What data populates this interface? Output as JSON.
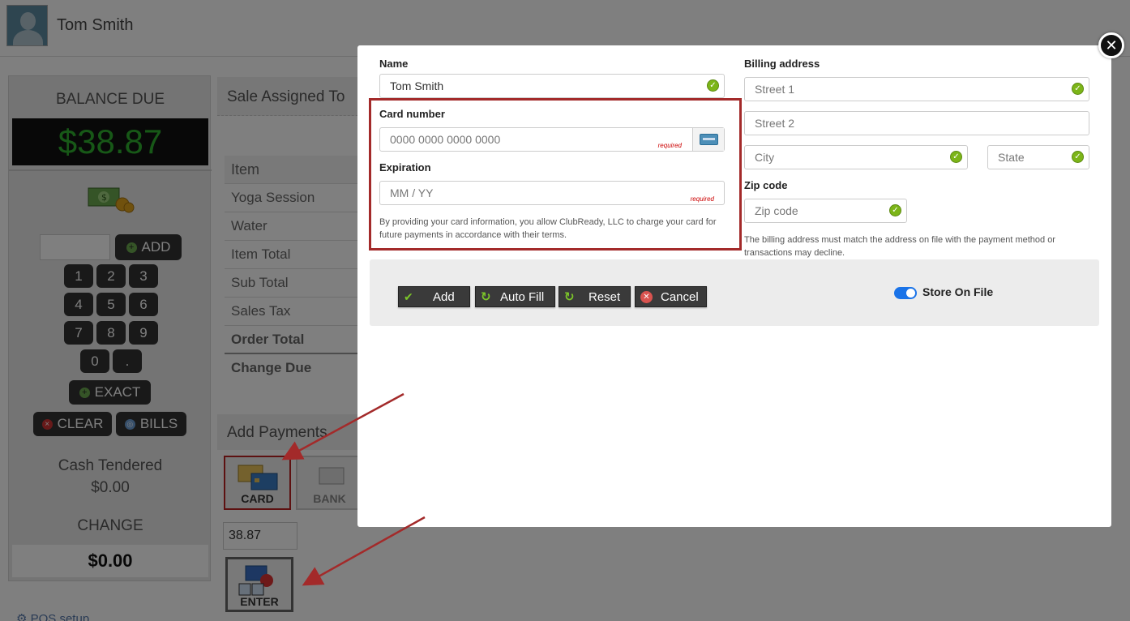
{
  "user": {
    "name": "Tom Smith"
  },
  "pos": {
    "balance_label": "BALANCE DUE",
    "balance_value": "$38.87",
    "add_label": "ADD",
    "keys": [
      "1",
      "2",
      "3",
      "4",
      "5",
      "6",
      "7",
      "8",
      "9",
      "0",
      "."
    ],
    "exact_label": "EXACT",
    "clear_label": "CLEAR",
    "bills_label": "BILLS",
    "cash_tendered_label": "Cash Tendered",
    "cash_tendered_value": "$0.00",
    "change_label": "CHANGE",
    "change_value": "$0.00",
    "pos_setup_label": "POS setup"
  },
  "sale": {
    "assigned_label": "Sale Assigned To",
    "item_header": "Item",
    "rows": [
      "Yoga Session",
      "Water",
      "Item Total",
      "Sub Total",
      "Sales Tax"
    ],
    "order_total_label": "Order Total",
    "change_due_label": "Change Due",
    "add_payments_label": "Add Payments",
    "card_tile_label": "CARD",
    "bank_tile_label": "BANK",
    "amount_value": "38.87",
    "enter_label": "ENTER"
  },
  "modal": {
    "name_label": "Name",
    "name_value": "Tom Smith",
    "card_number_label": "Card number",
    "card_number_placeholder": "0000 0000 0000 0000",
    "required_text": "required",
    "expiration_label": "Expiration",
    "expiration_placeholder": "MM / YY",
    "card_note": "By providing your card information, you allow ClubReady, LLC to charge your card for future payments in accordance with their terms.",
    "billing_label": "Billing address",
    "street1_placeholder": "Street 1",
    "street2_placeholder": "Street 2",
    "city_placeholder": "City",
    "state_placeholder": "State",
    "zip_label": "Zip code",
    "zip_placeholder": "Zip code",
    "billing_note": "The billing address must match the address on file with the payment method or transactions may decline.",
    "buttons": {
      "add": "Add",
      "autofill": "Auto Fill",
      "reset": "Reset",
      "cancel": "Cancel"
    },
    "store_on_file_label": "Store On File",
    "store_on_file_enabled": true
  },
  "colors": {
    "highlight": "#a32a2a",
    "accent": "#1a73e8",
    "valid": "#7cb518",
    "balance_text": "#2fb12f"
  }
}
